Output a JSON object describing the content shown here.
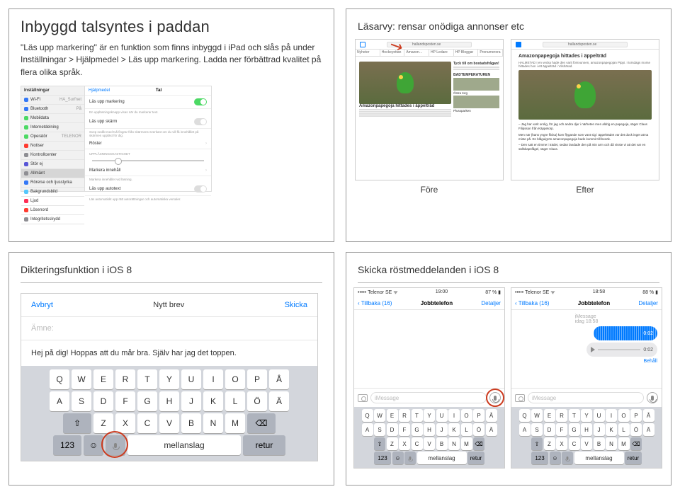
{
  "q1": {
    "title": "Inbyggd talsyntes i paddan",
    "para_pre": "\"Läs upp markering\" är en funktion som finns inbyggd i iPad och slås på under ",
    "para_bold": "Inställningar > Hjälpmedel > Läs upp markering",
    "para_post": ". Ladda ner förbättrad kvalitet på flera olika språk.",
    "side": {
      "header": "Inställningar",
      "wifi": "Wi-Fi",
      "wifi_val": "HA_Surfnet",
      "bt": "Bluetooth",
      "bt_val": "På",
      "mobil": "Mobildata",
      "internet": "Internetdelning",
      "operator": "Operatör",
      "operator_val": "TELENOR",
      "notiser": "Notiser",
      "kontroll": "Kontrollcenter",
      "stor": "Stör ej",
      "allmant": "Allmänt",
      "rorelse": "Rörelse och ljusstyrka",
      "bakgrund": "Bakgrundsbild",
      "ljud": "Ljud",
      "losen": "Lösenord",
      "integritet": "Integritetsskydd"
    },
    "main": {
      "back": "Hjälpmedel",
      "title": "Tal",
      "row1": "Läs upp markering",
      "row1_sub": "En uppläsningsknapp visas när du markerar text.",
      "row2": "Läs upp skärm",
      "row2_sub": "Svep nedåt med två fingrar från skärmens överkant om du vill få innehållet på skärmen uppläst för dig.",
      "row3": "Röster",
      "row3_sub": "UPPLÄSNINGSHASTIGHET",
      "row4": "Markera innehåll",
      "row4_sub": "Markera innehållet vid läsning.",
      "row5": "Läs upp autotext",
      "row5_sub": "Läs automatiskt upp rätt autorättningar och automatiska versaler."
    }
  },
  "q2": {
    "title": "Läsarvy: rensar onödiga annonser etc",
    "url": "hallandsposten.se",
    "tabs": [
      "Nyheter",
      "Hockeyettan",
      "Amazon…",
      "HP Ledare",
      "HP Bloggar",
      "Prenumerera"
    ],
    "headline": "Amazonpapegoja hittades i äppelträd",
    "side_hl1": "Tyck till om bostadsfrågan!",
    "side_hl2": "BADTEMPERATUREN",
    "side_thumb1": "Östra torg",
    "side_thumb2": "Plussparken",
    "after_title": "Amazonpapegoja hittades i äppelträd",
    "after_sub": "HALMSTAD I en vecka hade den varit försvunnen, amazonpapegojan Pippi. I torsdags morse hittades hon i ett äppelträd i Vilshärad.",
    "after_body1": "– Jag har varit orolig, för jag och andra djur i närheten men aldrig en papegoja, säger Claus Filipsson från Käppetorp.",
    "after_body2": "Men när (hans yngre flicka) kom flygande som vant sig i äppelträdet var det dock inget att ta miste på. En blågulgrön amazonpapegoja hade kommit till besök.",
    "after_body3": "– Den satt en timme i trädet, sedan landade den på min arm och då visste vi att det var en sällskapsfågel, säger Claus.",
    "label_before": "Före",
    "label_after": "Efter"
  },
  "q3": {
    "title": "Dikteringsfunktion i iOS 8",
    "cancel": "Avbryt",
    "center": "Nytt brev",
    "send": "Skicka",
    "subject": "Ämne:",
    "body": "Hej på dig! Hoppas att du mår bra. Själv har jag det toppen.",
    "rows": {
      "r1": [
        "Q",
        "W",
        "E",
        "R",
        "T",
        "Y",
        "U",
        "I",
        "O",
        "P",
        "Å"
      ],
      "r2": [
        "A",
        "S",
        "D",
        "F",
        "G",
        "H",
        "J",
        "K",
        "L",
        "Ö",
        "Ä"
      ],
      "r3": [
        "Z",
        "X",
        "C",
        "V",
        "B",
        "N",
        "M"
      ],
      "num": "123",
      "space": "mellanslag",
      "return": "retur"
    }
  },
  "q4": {
    "title": "Skicka röstmeddelanden i iOS 8",
    "carrier": "Telenor SE",
    "time1": "19:00",
    "batt1": "87 %",
    "time2": "18:58",
    "batt2": "88 %",
    "back": "Tillbaka (16)",
    "name": "Jobbtelefon",
    "details": "Detaljer",
    "imessage_label": "iMessage",
    "timestamp": "idag 18:58",
    "rec_dur": "0:02",
    "play_dur": "0:02",
    "keep": "Behåll",
    "placeholder": "iMessage",
    "rows": {
      "r1": [
        "Q",
        "W",
        "E",
        "R",
        "T",
        "Y",
        "U",
        "I",
        "O",
        "P",
        "Å"
      ],
      "r2": [
        "A",
        "S",
        "D",
        "F",
        "G",
        "H",
        "J",
        "K",
        "L",
        "Ö",
        "Ä"
      ],
      "r3": [
        "Z",
        "X",
        "C",
        "V",
        "B",
        "N",
        "M"
      ],
      "num": "123",
      "space": "mellanslag",
      "return": "retur"
    }
  }
}
